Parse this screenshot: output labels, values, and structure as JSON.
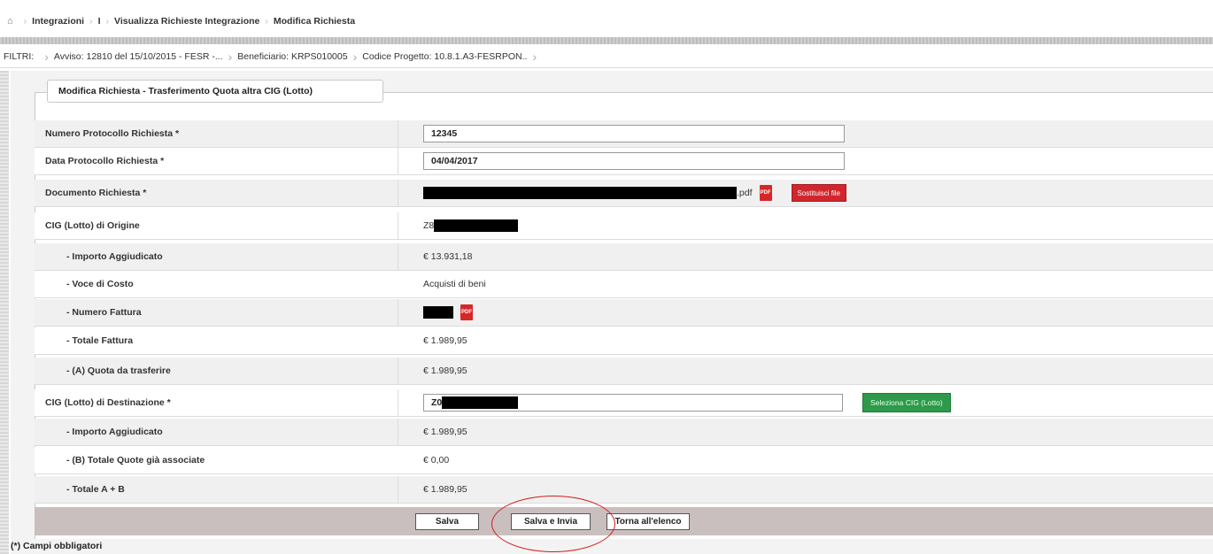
{
  "breadcrumb": {
    "home_icon": "home-icon",
    "items": [
      "Integrazioni",
      "I",
      "Visualizza Richieste Integrazione",
      "Modifica Richiesta"
    ]
  },
  "filters": {
    "label": "FILTRI:",
    "chips": [
      "Avviso: 12810 del 15/10/2015 - FESR -...",
      "Beneficiario: KRPS010005",
      "Codice Progetto: 10.8.1.A3-FESRPON.."
    ]
  },
  "form": {
    "legend": "Modifica Richiesta - Trasferimento Quota altra CIG (Lotto)",
    "numero_protocollo": {
      "label": "Numero Protocollo Richiesta *",
      "value": "12345"
    },
    "data_protocollo": {
      "label": "Data Protocollo Richiesta *",
      "value": "04/04/2017"
    },
    "documento": {
      "label": "Documento Richiesta *",
      "suffix": ".pdf",
      "button": "Sostituisci file"
    },
    "cig_origine": {
      "label": "CIG (Lotto) di Origine",
      "value_prefix": "Z8"
    },
    "importo_aggiudicato_1": {
      "label": "- Importo Aggiudicato",
      "value": "€ 13.931,18"
    },
    "voce_costo": {
      "label": "- Voce di Costo",
      "value": "Acquisti di beni"
    },
    "numero_fattura": {
      "label": "- Numero Fattura"
    },
    "totale_fattura": {
      "label": "- Totale Fattura",
      "value": "€ 1.989,95"
    },
    "quota_trasferire": {
      "label": "- (A) Quota da trasferire",
      "value": "€ 1.989,95"
    },
    "cig_destinazione": {
      "label": "CIG (Lotto) di Destinazione *",
      "value_prefix": "Z0",
      "button": "Seleziona CIG (Lotto)"
    },
    "importo_aggiudicato_2": {
      "label": "- Importo Aggiudicato",
      "value": "€ 1.989,95"
    },
    "totale_quote": {
      "label": "- (B) Totale Quote già associate",
      "value": "€ 0,00"
    },
    "totale_ab": {
      "label": "- Totale A + B",
      "value": "€ 1.989,95"
    }
  },
  "actions": {
    "salva": "Salva",
    "salva_invia": "Salva e Invia",
    "torna": "Torna all'elenco"
  },
  "footnote": "(*) Campi obbligatori",
  "colors": {
    "red_button": "#d0262d",
    "green_button": "#2c9a4a",
    "highlight_circle": "#d21c1c"
  }
}
